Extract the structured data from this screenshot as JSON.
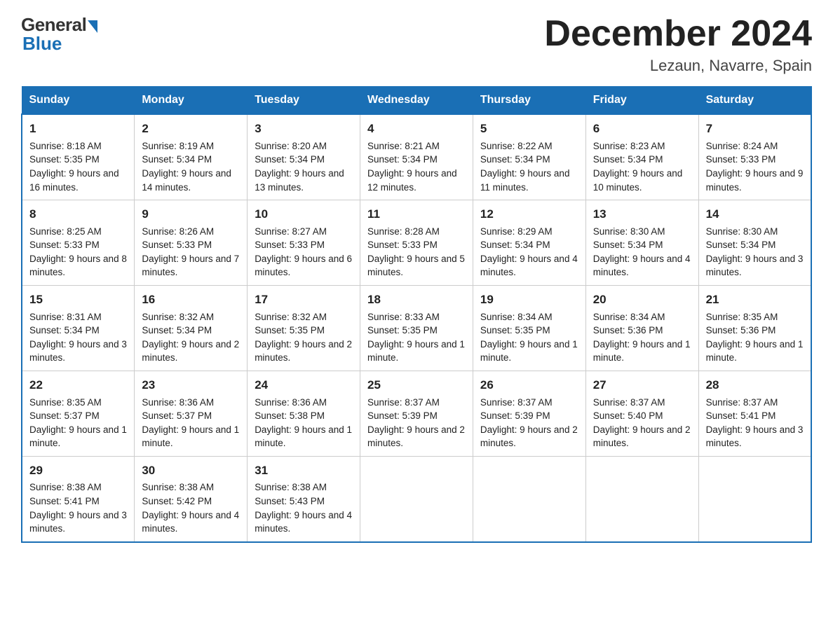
{
  "logo": {
    "general": "General",
    "blue": "Blue"
  },
  "title": "December 2024",
  "subtitle": "Lezaun, Navarre, Spain",
  "days_of_week": [
    "Sunday",
    "Monday",
    "Tuesday",
    "Wednesday",
    "Thursday",
    "Friday",
    "Saturday"
  ],
  "weeks": [
    [
      {
        "day": "1",
        "sunrise": "8:18 AM",
        "sunset": "5:35 PM",
        "daylight": "9 hours and 16 minutes."
      },
      {
        "day": "2",
        "sunrise": "8:19 AM",
        "sunset": "5:34 PM",
        "daylight": "9 hours and 14 minutes."
      },
      {
        "day": "3",
        "sunrise": "8:20 AM",
        "sunset": "5:34 PM",
        "daylight": "9 hours and 13 minutes."
      },
      {
        "day": "4",
        "sunrise": "8:21 AM",
        "sunset": "5:34 PM",
        "daylight": "9 hours and 12 minutes."
      },
      {
        "day": "5",
        "sunrise": "8:22 AM",
        "sunset": "5:34 PM",
        "daylight": "9 hours and 11 minutes."
      },
      {
        "day": "6",
        "sunrise": "8:23 AM",
        "sunset": "5:34 PM",
        "daylight": "9 hours and 10 minutes."
      },
      {
        "day": "7",
        "sunrise": "8:24 AM",
        "sunset": "5:33 PM",
        "daylight": "9 hours and 9 minutes."
      }
    ],
    [
      {
        "day": "8",
        "sunrise": "8:25 AM",
        "sunset": "5:33 PM",
        "daylight": "9 hours and 8 minutes."
      },
      {
        "day": "9",
        "sunrise": "8:26 AM",
        "sunset": "5:33 PM",
        "daylight": "9 hours and 7 minutes."
      },
      {
        "day": "10",
        "sunrise": "8:27 AM",
        "sunset": "5:33 PM",
        "daylight": "9 hours and 6 minutes."
      },
      {
        "day": "11",
        "sunrise": "8:28 AM",
        "sunset": "5:33 PM",
        "daylight": "9 hours and 5 minutes."
      },
      {
        "day": "12",
        "sunrise": "8:29 AM",
        "sunset": "5:34 PM",
        "daylight": "9 hours and 4 minutes."
      },
      {
        "day": "13",
        "sunrise": "8:30 AM",
        "sunset": "5:34 PM",
        "daylight": "9 hours and 4 minutes."
      },
      {
        "day": "14",
        "sunrise": "8:30 AM",
        "sunset": "5:34 PM",
        "daylight": "9 hours and 3 minutes."
      }
    ],
    [
      {
        "day": "15",
        "sunrise": "8:31 AM",
        "sunset": "5:34 PM",
        "daylight": "9 hours and 3 minutes."
      },
      {
        "day": "16",
        "sunrise": "8:32 AM",
        "sunset": "5:34 PM",
        "daylight": "9 hours and 2 minutes."
      },
      {
        "day": "17",
        "sunrise": "8:32 AM",
        "sunset": "5:35 PM",
        "daylight": "9 hours and 2 minutes."
      },
      {
        "day": "18",
        "sunrise": "8:33 AM",
        "sunset": "5:35 PM",
        "daylight": "9 hours and 1 minute."
      },
      {
        "day": "19",
        "sunrise": "8:34 AM",
        "sunset": "5:35 PM",
        "daylight": "9 hours and 1 minute."
      },
      {
        "day": "20",
        "sunrise": "8:34 AM",
        "sunset": "5:36 PM",
        "daylight": "9 hours and 1 minute."
      },
      {
        "day": "21",
        "sunrise": "8:35 AM",
        "sunset": "5:36 PM",
        "daylight": "9 hours and 1 minute."
      }
    ],
    [
      {
        "day": "22",
        "sunrise": "8:35 AM",
        "sunset": "5:37 PM",
        "daylight": "9 hours and 1 minute."
      },
      {
        "day": "23",
        "sunrise": "8:36 AM",
        "sunset": "5:37 PM",
        "daylight": "9 hours and 1 minute."
      },
      {
        "day": "24",
        "sunrise": "8:36 AM",
        "sunset": "5:38 PM",
        "daylight": "9 hours and 1 minute."
      },
      {
        "day": "25",
        "sunrise": "8:37 AM",
        "sunset": "5:39 PM",
        "daylight": "9 hours and 2 minutes."
      },
      {
        "day": "26",
        "sunrise": "8:37 AM",
        "sunset": "5:39 PM",
        "daylight": "9 hours and 2 minutes."
      },
      {
        "day": "27",
        "sunrise": "8:37 AM",
        "sunset": "5:40 PM",
        "daylight": "9 hours and 2 minutes."
      },
      {
        "day": "28",
        "sunrise": "8:37 AM",
        "sunset": "5:41 PM",
        "daylight": "9 hours and 3 minutes."
      }
    ],
    [
      {
        "day": "29",
        "sunrise": "8:38 AM",
        "sunset": "5:41 PM",
        "daylight": "9 hours and 3 minutes."
      },
      {
        "day": "30",
        "sunrise": "8:38 AM",
        "sunset": "5:42 PM",
        "daylight": "9 hours and 4 minutes."
      },
      {
        "day": "31",
        "sunrise": "8:38 AM",
        "sunset": "5:43 PM",
        "daylight": "9 hours and 4 minutes."
      },
      null,
      null,
      null,
      null
    ]
  ]
}
